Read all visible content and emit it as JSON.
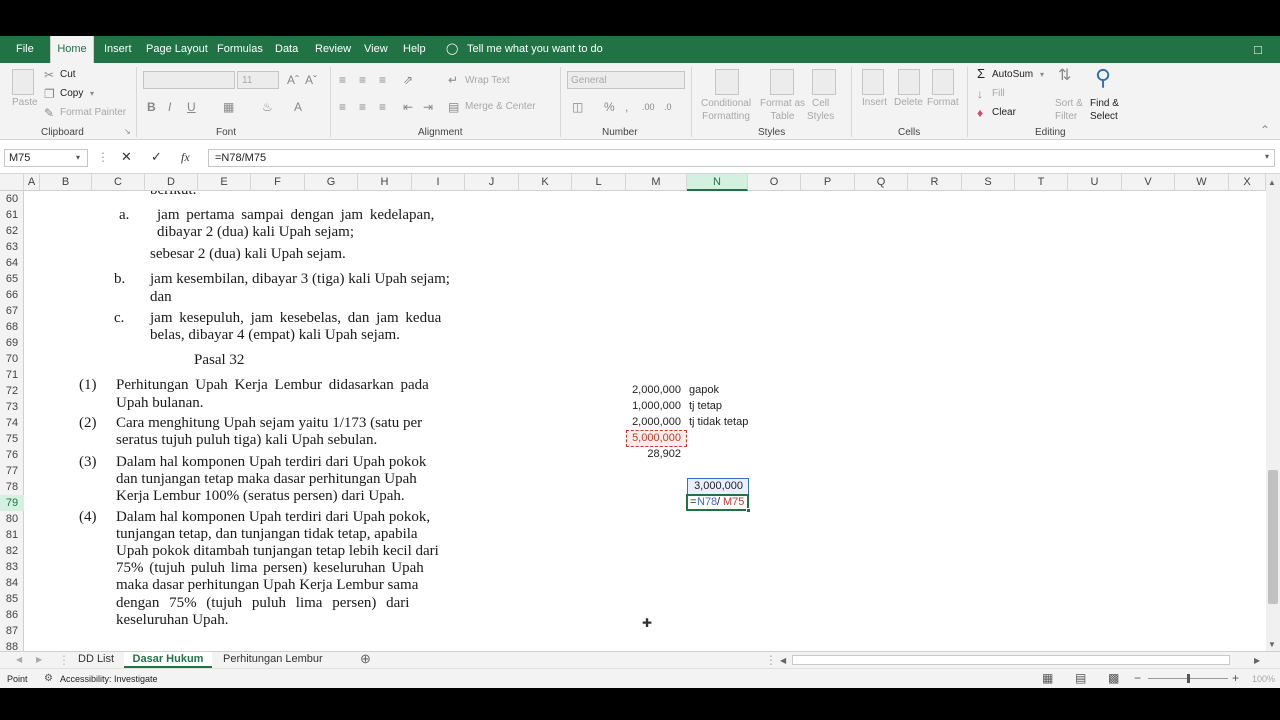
{
  "menu": {
    "tabs": [
      "File",
      "Home",
      "Insert",
      "Page Layout",
      "Formulas",
      "Data",
      "Review",
      "View",
      "Help"
    ],
    "tell_me": "Tell me what you want to do"
  },
  "ribbon": {
    "clipboard": {
      "paste": "Paste",
      "cut": "Cut",
      "copy": "Copy",
      "format_painter": "Format Painter",
      "label": "Clipboard"
    },
    "font": {
      "size": "11",
      "label": "Font"
    },
    "alignment": {
      "wrap_text": "Wrap Text",
      "merge_center": "Merge & Center",
      "label": "Alignment"
    },
    "number": {
      "format": "General",
      "label": "Number"
    },
    "styles": {
      "conditional_formatting": "Conditional\nFormatting",
      "format_as_table": "Format as\nTable",
      "cell_styles": "Cell\nStyles",
      "label": "Styles"
    },
    "cells": {
      "insert": "Insert",
      "delete": "Delete",
      "format": "Format",
      "label": "Cells"
    },
    "editing": {
      "autosum": "AutoSum",
      "fill": "Fill",
      "clear": "Clear",
      "sort_filter": "Sort &\nFilter",
      "find_select": "Find &\nSelect",
      "label": "Editing"
    }
  },
  "formula_bar": {
    "name_box": "M75",
    "formula": "=N78/M75"
  },
  "columns": [
    "A",
    "B",
    "C",
    "D",
    "E",
    "F",
    "G",
    "H",
    "I",
    "J",
    "K",
    "L",
    "M",
    "N",
    "O",
    "P",
    "Q",
    "R",
    "S",
    "T",
    "U",
    "V",
    "W",
    "X"
  ],
  "selected_column": "N",
  "rows": [
    "60",
    "61",
    "62",
    "63",
    "64",
    "65",
    "66",
    "67",
    "68",
    "69",
    "70",
    "71",
    "72",
    "73",
    "74",
    "75",
    "76",
    "77",
    "78",
    "79",
    "80",
    "81",
    "82",
    "83",
    "84",
    "85",
    "86",
    "87",
    "88"
  ],
  "selected_row": "79",
  "document_text": {
    "partial_top": "berikut:",
    "a_marker": "a.",
    "a_line1": "jam pertama sampai dengan jam kedelapan,",
    "a_line2": "dibayar 2 (dua) kali Upah sejam;",
    "a_line3": "sebesar 2 (dua) kali Upah sejam.",
    "b_marker": "b.",
    "b_line1": "jam kesembilan, dibayar 3 (tiga) kali Upah sejam;",
    "b_line2": "dan",
    "c_marker": "c.",
    "c_line1": "jam kesepuluh, jam kesebelas, dan jam kedua",
    "c_line2": "belas, dibayar 4 (empat) kali Upah sejam.",
    "pasal": "Pasal 32",
    "p1_marker": "(1)",
    "p1_line1": "Perhitungan Upah Kerja Lembur didasarkan pada",
    "p1_line2": "Upah bulanan.",
    "p2_marker": "(2)",
    "p2_line1": "Cara menghitung Upah sejam yaitu 1/173 (satu per",
    "p2_line2": "seratus tujuh puluh tiga) kali Upah sebulan.",
    "p3_marker": "(3)",
    "p3_line1": "Dalam hal komponen Upah terdiri dari Upah pokok",
    "p3_line2": "dan tunjangan tetap maka dasar perhitungan Upah",
    "p3_line3": "Kerja Lembur 100% (seratus persen) dari Upah.",
    "p4_marker": "(4)",
    "p4_line1": "Dalam hal komponen Upah terdiri dari Upah pokok,",
    "p4_line2": "tunjangan tetap, dan tunjangan tidak tetap, apabila",
    "p4_line3": "Upah pokok ditambah tunjangan tetap lebih kecil dari",
    "p4_line4": "75% (tujuh puluh lima persen) keseluruhan Upah",
    "p4_line5": "maka dasar perhitungan Upah Kerja Lembur sama",
    "p4_line6": "dengan 75% (tujuh puluh lima persen) dari",
    "p4_line7": "keseluruhan Upah."
  },
  "cells": {
    "m72": "2,000,000",
    "n72": "gapok",
    "m73": "1,000,000",
    "n73": "tj tetap",
    "m74": "2,000,000",
    "n74": "tj tidak tetap",
    "m75": "5,000,000",
    "m76": "28,902",
    "n78": "3,000,000",
    "n79_a": "=",
    "n79_b": "N78",
    "n79_c": "/",
    "n79_d": "M75"
  },
  "sheets": [
    "DD List",
    "Dasar Hukum",
    "Perhitungan Lembur"
  ],
  "active_sheet": "Dasar Hukum",
  "status": {
    "mode": "Point",
    "accessibility": "Accessibility: Investigate",
    "zoom": "100%"
  },
  "colors": {
    "excel_green": "#217346",
    "ref_blue": "#3b6ccc",
    "ref_red": "#c0392b"
  }
}
